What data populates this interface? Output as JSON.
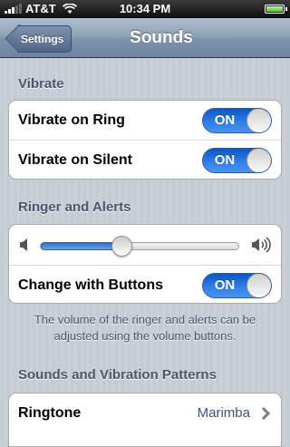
{
  "status_bar": {
    "carrier": "AT&T",
    "time": "10:34 PM",
    "signal_icon": "signal-bars-icon",
    "wifi_icon": "wifi-icon",
    "battery_icon": "battery-icon"
  },
  "nav": {
    "back_label": "Settings",
    "title": "Sounds"
  },
  "sections": {
    "vibrate": {
      "header": "Vibrate",
      "rows": [
        {
          "label": "Vibrate on Ring",
          "toggle": "ON"
        },
        {
          "label": "Vibrate on Silent",
          "toggle": "ON"
        }
      ]
    },
    "ringer": {
      "header": "Ringer and Alerts",
      "volume_level": 0.41,
      "low_icon": "volume-low-icon",
      "high_icon": "volume-high-icon",
      "change_with_buttons": {
        "label": "Change with Buttons",
        "toggle": "ON"
      },
      "footnote": "The volume of the ringer and alerts can be adjusted using the volume buttons."
    },
    "patterns": {
      "header": "Sounds and Vibration Patterns",
      "ringtone": {
        "label": "Ringtone",
        "value": "Marimba"
      }
    }
  },
  "colors": {
    "toggle_on": "#2f7ee8",
    "section_text": "#4c566c",
    "value_text": "#385487"
  }
}
